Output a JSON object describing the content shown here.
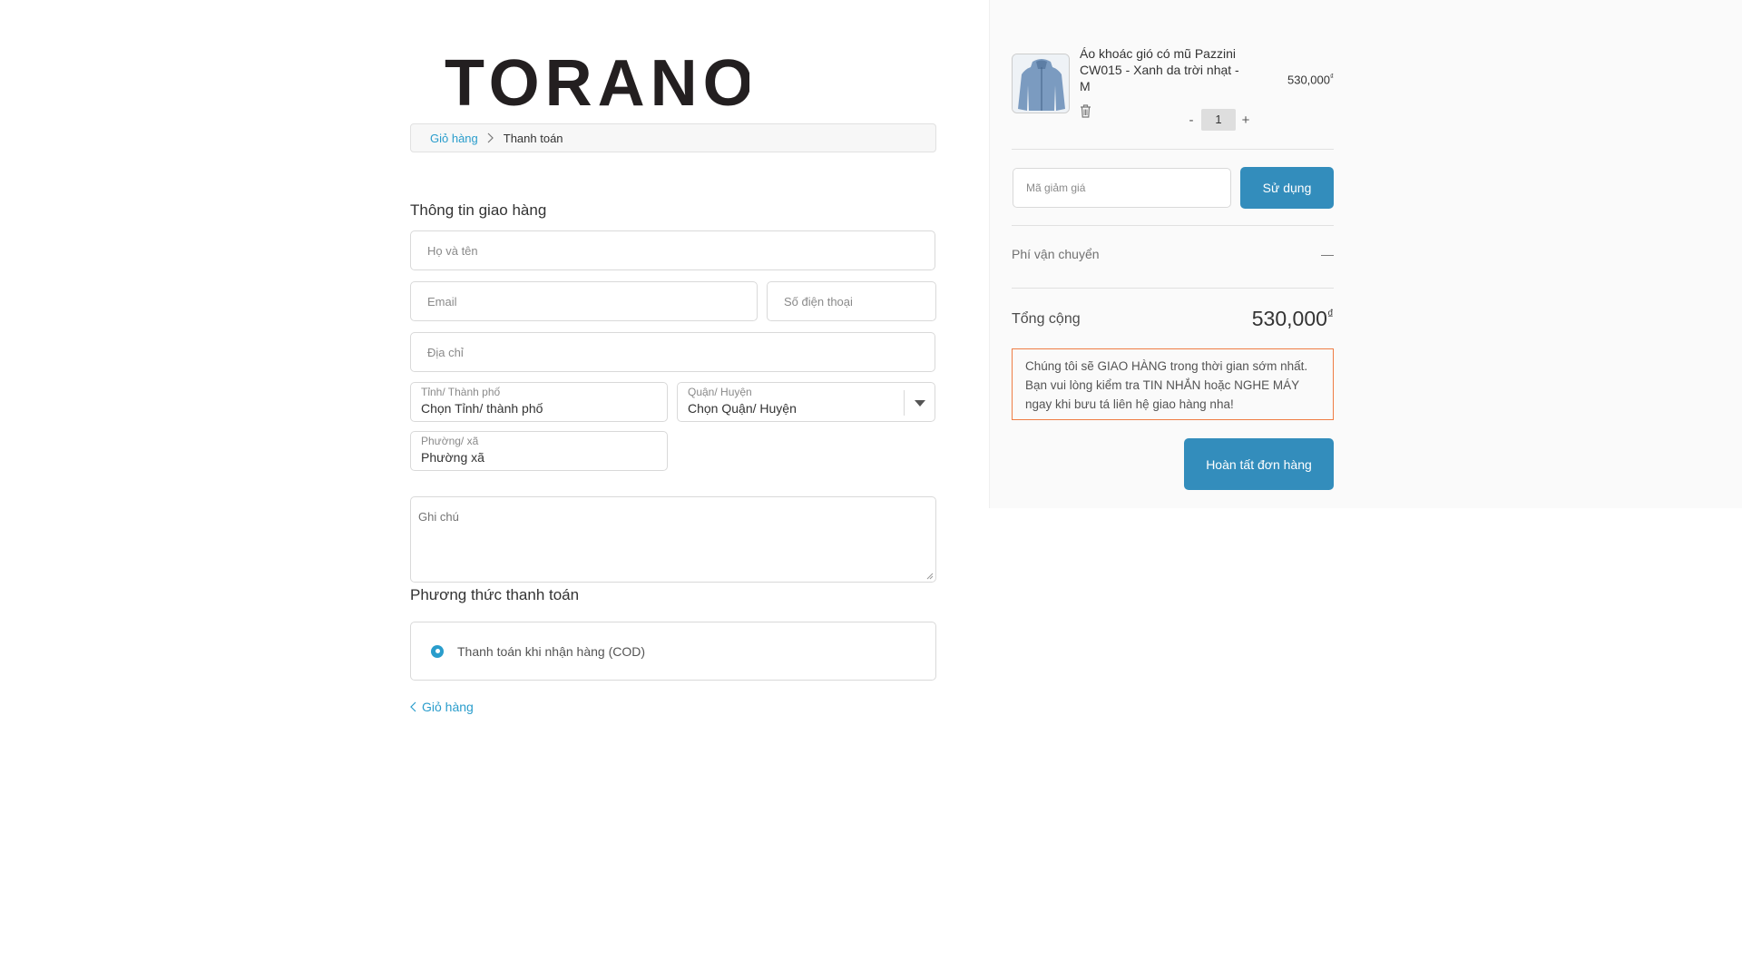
{
  "brand": {
    "logo_text": "TORANO"
  },
  "breadcrumb": {
    "cart_label": "Giỏ hàng",
    "current_label": "Thanh toán"
  },
  "shipping": {
    "title": "Thông tin giao hàng",
    "name_placeholder": "Họ và tên",
    "email_placeholder": "Email",
    "phone_placeholder": "Số điện thoại",
    "address_placeholder": "Địa chỉ",
    "province": {
      "label": "Tỉnh/ Thành phố",
      "value": "Chọn Tỉnh/ thành phố"
    },
    "district": {
      "label": "Quận/ Huyện",
      "value": "Chọn Quận/ Huyện"
    },
    "ward": {
      "label": "Phường/ xã",
      "value": "Phường xã"
    },
    "note_placeholder": "Ghi chú"
  },
  "payment": {
    "title": "Phương thức thanh toán",
    "option_label": "Thanh toán khi nhận hàng (COD)",
    "selected": true
  },
  "back_link": "Giỏ hàng",
  "cart": {
    "product_name": "Áo khoác gió có mũ Pazzini CW015 - Xanh da trời nhạt - M",
    "product_price": "530,000",
    "currency": "₫",
    "quantity": "1",
    "qty_minus": "-",
    "qty_plus": "+"
  },
  "discount": {
    "placeholder": "Mã giảm giá",
    "button_label": "Sử dụng"
  },
  "shipping_fee": {
    "label": "Phí vận chuyển",
    "value": "—"
  },
  "total": {
    "label": "Tổng cộng",
    "value": "530,000",
    "currency": "₫"
  },
  "notice": "Chúng tôi sẽ GIAO HÀNG trong thời gian sớm nhất. Bạn vui lòng kiểm tra TIN NHẮN hoặc NGHE MÁY ngay khi bưu tá liên hệ giao hàng nha!",
  "complete_button": "Hoàn tất đơn hàng",
  "colors": {
    "accent": "#338dbc",
    "link": "#2a9dcc",
    "notice_border": "#ef7d45"
  }
}
